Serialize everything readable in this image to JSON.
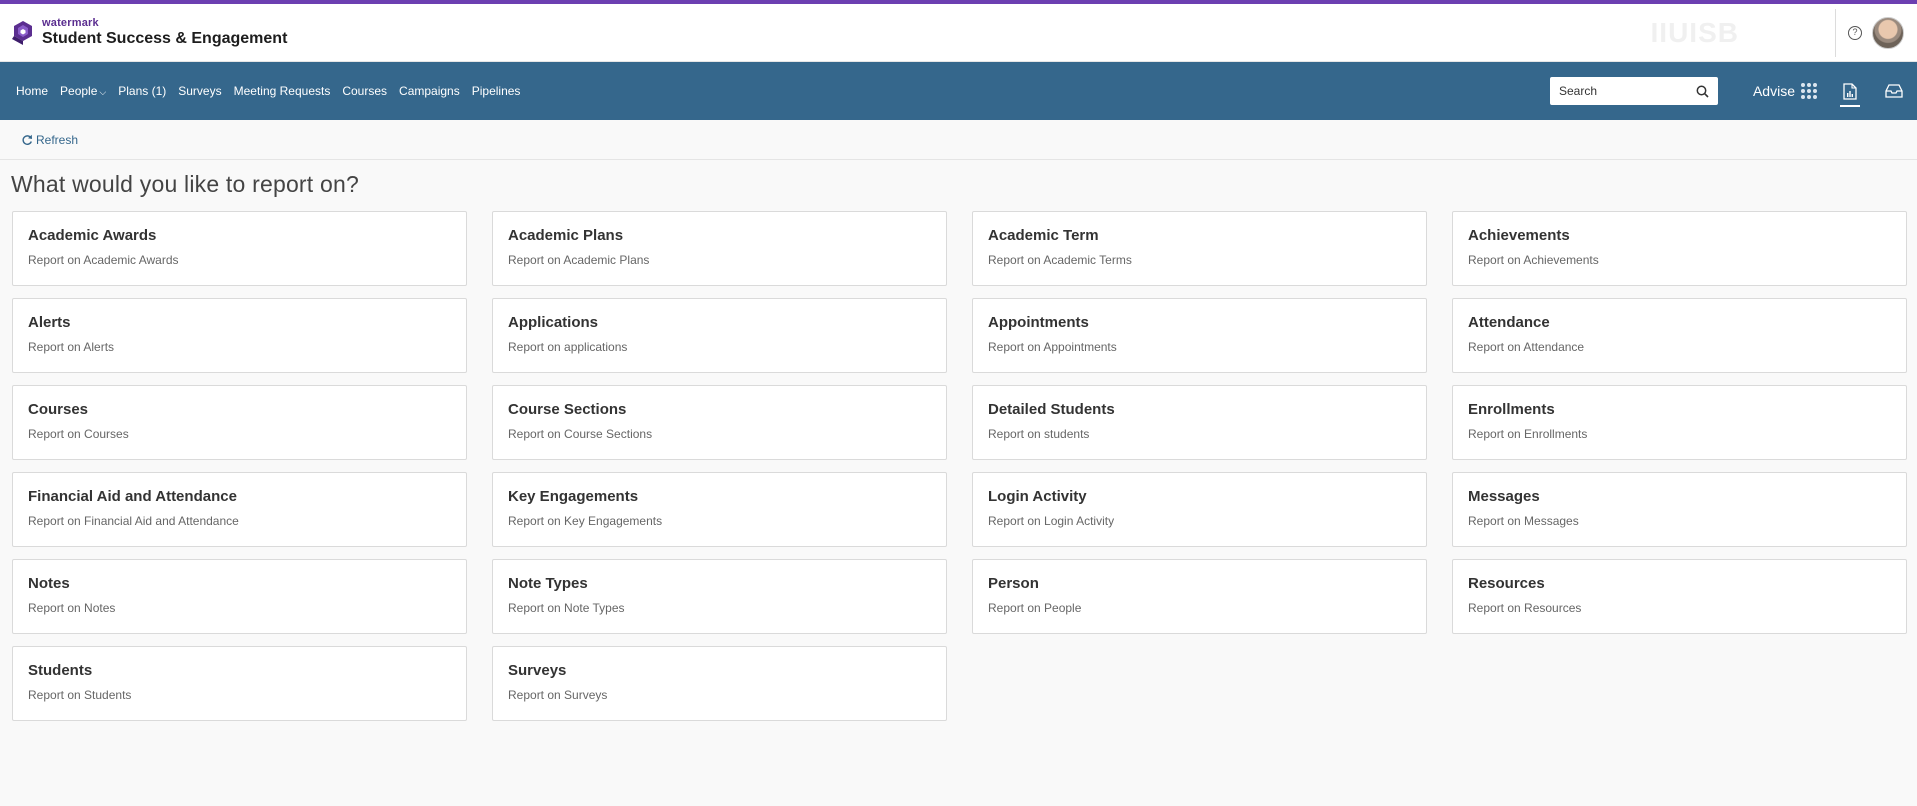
{
  "brand": {
    "small": "watermark",
    "title": "Student Success & Engagement",
    "faded_logo": "IIUISB"
  },
  "nav": {
    "items": [
      {
        "label": "Home"
      },
      {
        "label": "People"
      },
      {
        "label": "Plans (1)"
      },
      {
        "label": "Surveys"
      },
      {
        "label": "Meeting Requests"
      },
      {
        "label": "Courses"
      },
      {
        "label": "Campaigns"
      },
      {
        "label": "Pipelines"
      }
    ],
    "search_placeholder": "Search",
    "advise_label": "Advise"
  },
  "toolbar": {
    "refresh_label": "Refresh"
  },
  "page": {
    "title": "What would you like to report on?"
  },
  "cards": [
    {
      "title": "Academic Awards",
      "subtitle": "Report on Academic Awards"
    },
    {
      "title": "Academic Plans",
      "subtitle": "Report on Academic Plans"
    },
    {
      "title": "Academic Term",
      "subtitle": "Report on Academic Terms"
    },
    {
      "title": "Achievements",
      "subtitle": "Report on Achievements"
    },
    {
      "title": "Alerts",
      "subtitle": "Report on Alerts"
    },
    {
      "title": "Applications",
      "subtitle": "Report on applications"
    },
    {
      "title": "Appointments",
      "subtitle": "Report on Appointments"
    },
    {
      "title": "Attendance",
      "subtitle": "Report on Attendance"
    },
    {
      "title": "Courses",
      "subtitle": "Report on Courses"
    },
    {
      "title": "Course Sections",
      "subtitle": "Report on Course Sections"
    },
    {
      "title": "Detailed Students",
      "subtitle": "Report on students"
    },
    {
      "title": "Enrollments",
      "subtitle": "Report on Enrollments"
    },
    {
      "title": "Financial Aid and Attendance",
      "subtitle": "Report on Financial Aid and Attendance"
    },
    {
      "title": "Key Engagements",
      "subtitle": "Report on Key Engagements"
    },
    {
      "title": "Login Activity",
      "subtitle": "Report on Login Activity"
    },
    {
      "title": "Messages",
      "subtitle": "Report on Messages"
    },
    {
      "title": "Notes",
      "subtitle": "Report on Notes"
    },
    {
      "title": "Note Types",
      "subtitle": "Report on Note Types"
    },
    {
      "title": "Person",
      "subtitle": "Report on People"
    },
    {
      "title": "Resources",
      "subtitle": "Report on Resources"
    },
    {
      "title": "Students",
      "subtitle": "Report on Students"
    },
    {
      "title": "Surveys",
      "subtitle": "Report on Surveys"
    }
  ],
  "colors": {
    "accent_purple": "#6c3fb1",
    "nav_blue": "#35678c"
  }
}
